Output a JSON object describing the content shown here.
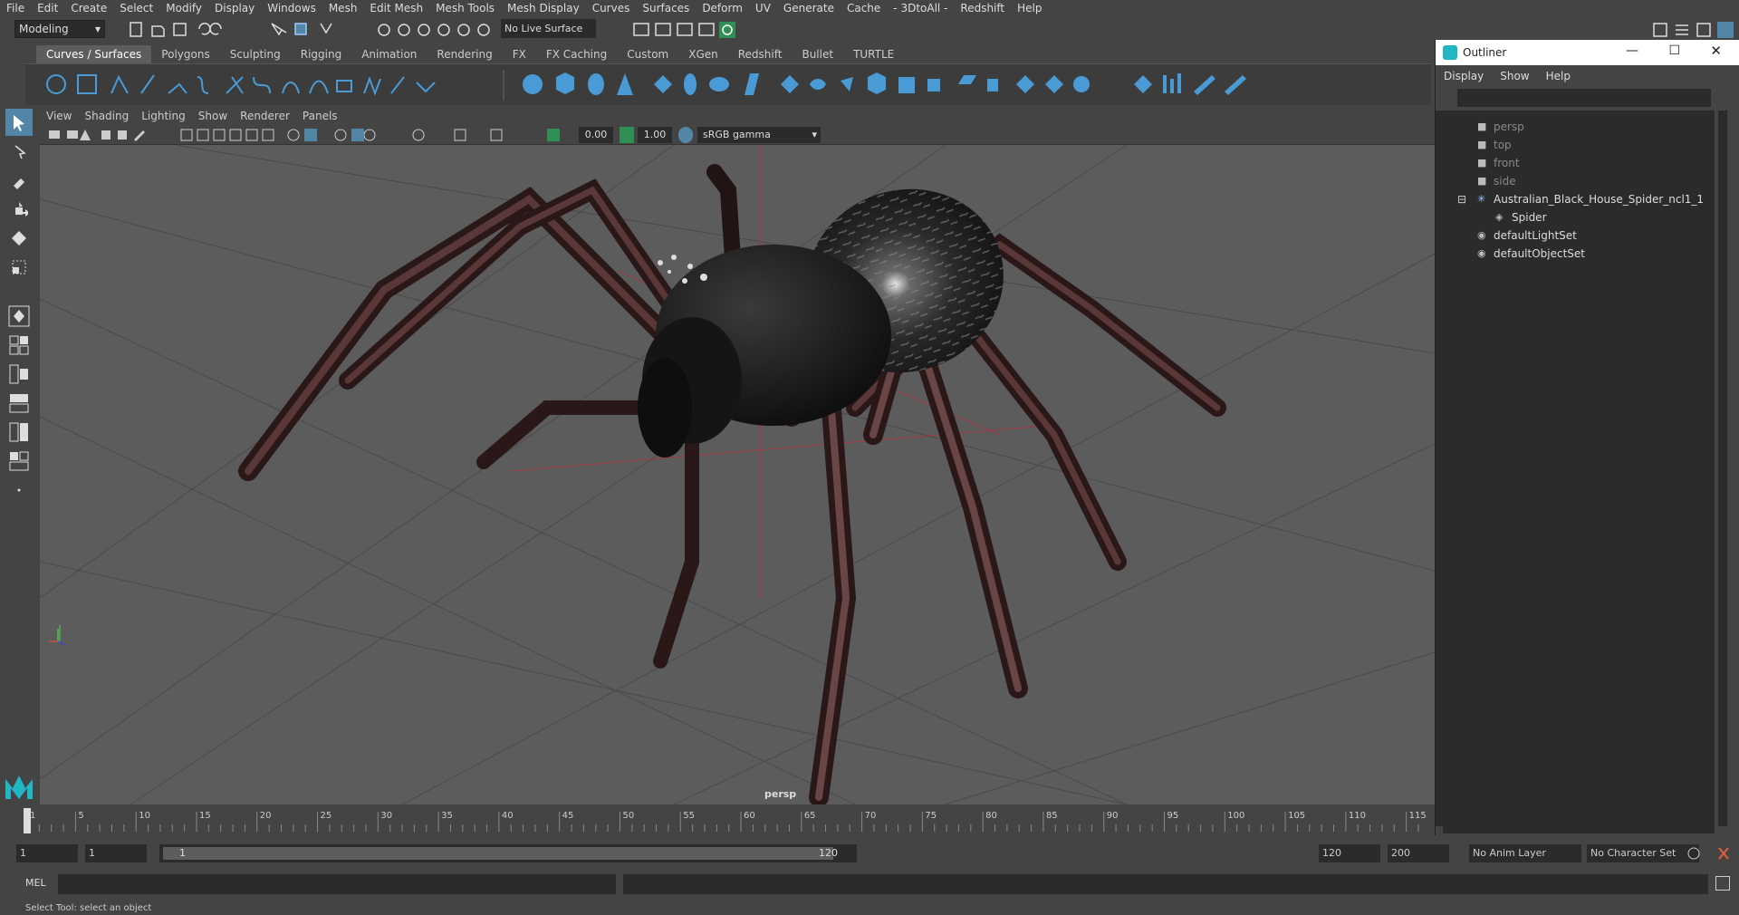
{
  "menubar": [
    "File",
    "Edit",
    "Create",
    "Select",
    "Modify",
    "Display",
    "Windows",
    "Mesh",
    "Edit Mesh",
    "Mesh Tools",
    "Mesh Display",
    "Curves",
    "Surfaces",
    "Deform",
    "UV",
    "Generate",
    "Cache",
    "- 3DtoAll -",
    "Redshift",
    "Help"
  ],
  "status": {
    "mode": "Modeling",
    "live_surface": "No Live Surface"
  },
  "shelf_tabs": [
    "Curves / Surfaces",
    "Polygons",
    "Sculpting",
    "Rigging",
    "Animation",
    "Rendering",
    "FX",
    "FX Caching",
    "Custom",
    "XGen",
    "Redshift",
    "Bullet",
    "TURTLE"
  ],
  "viewport": {
    "menu": [
      "View",
      "Shading",
      "Lighting",
      "Show",
      "Renderer",
      "Panels"
    ],
    "exposure": "0.00",
    "gamma": "1.00",
    "color_space": "sRGB gamma",
    "camera": "persp"
  },
  "outliner": {
    "title": "Outliner",
    "menu": [
      "Display",
      "Show",
      "Help"
    ],
    "items": [
      "persp",
      "top",
      "front",
      "side",
      "Australian_Black_House_Spider_ncl1_1",
      "Spider",
      "defaultLightSet",
      "defaultObjectSet"
    ]
  },
  "timeline": {
    "ticks": [
      "1",
      "5",
      "10",
      "15",
      "20",
      "25",
      "30",
      "35",
      "40",
      "45",
      "50",
      "55",
      "60",
      "65",
      "70",
      "75",
      "80",
      "85",
      "90",
      "95",
      "100",
      "105",
      "110",
      "115"
    ]
  },
  "range": {
    "start": "1",
    "current": "1",
    "slider_start": "1",
    "slider_end": "120",
    "end": "120",
    "max": "200",
    "anim_layer": "No Anim Layer",
    "char_set": "No Character Set"
  },
  "cmd": {
    "label": "MEL"
  },
  "help": "Select Tool: select an object",
  "colors": {
    "bg": "#444444",
    "viewport": "#5c5c5c",
    "accent": "#5285a6",
    "shelf_blue": "#4a9ad6"
  }
}
